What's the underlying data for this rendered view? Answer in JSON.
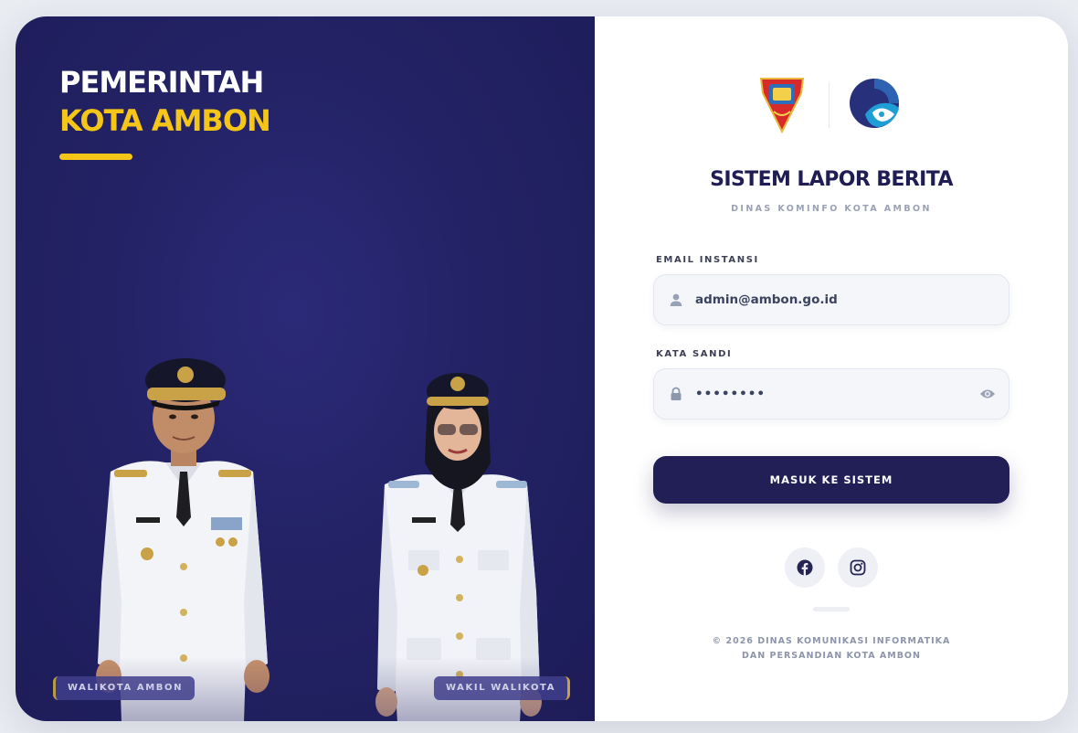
{
  "brand": {
    "line1": "PEMERINTAH",
    "line2": "KOTA AMBON",
    "accent_color": "#f5c518"
  },
  "officials": {
    "left_badge": "WALIKOTA AMBON",
    "right_badge": "WAKIL WALIKOTA"
  },
  "header": {
    "title": "SISTEM LAPOR BERITA",
    "subtitle": "DINAS KOMINFO KOTA AMBON",
    "logos": [
      "kota-ambon-crest",
      "kominfo-logo"
    ]
  },
  "form": {
    "email_label": "EMAIL INSTANSI",
    "email_value": "admin@ambon.go.id",
    "password_label": "KATA SANDI",
    "password_value": "••••••••",
    "submit_label": "MASUK KE SISTEM"
  },
  "social": [
    "facebook-icon",
    "instagram-icon"
  ],
  "footer": {
    "line1": "© 2026 DINAS KOMUNIKASI INFORMATIKA",
    "line2": "DAN PERSANDIAN KOTA AMBON"
  },
  "colors": {
    "panel_dark": "#1f1e5c",
    "button": "#221f57",
    "accent": "#f5c518"
  }
}
